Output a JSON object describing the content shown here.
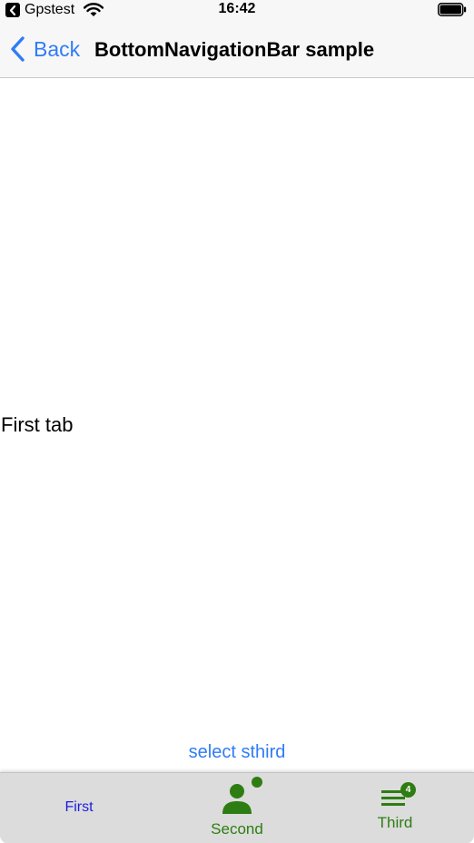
{
  "status_bar": {
    "carrier": "Gpstest",
    "time": "16:42",
    "icons": [
      "back-to-app-icon",
      "wifi-icon",
      "battery-icon"
    ]
  },
  "nav_bar": {
    "back_label": "Back",
    "title": "BottomNavigationBar sample"
  },
  "body": {
    "tab_text": "First tab",
    "select_third_label": "select sthird"
  },
  "bottom_nav": {
    "items": [
      {
        "label": "First",
        "icon": "",
        "selected": true
      },
      {
        "label": "Second",
        "icon": "person-dot-icon"
      },
      {
        "label": "Third",
        "icon": "menu-lines-icon",
        "badge": "4"
      }
    ]
  },
  "colors": {
    "accent_blue": "#2f7cf6",
    "first_label": "#1d1de0",
    "green": "#2e7d12",
    "bar_background": "#f7f7f7",
    "bottom_bar_background": "#dcdcdc"
  }
}
